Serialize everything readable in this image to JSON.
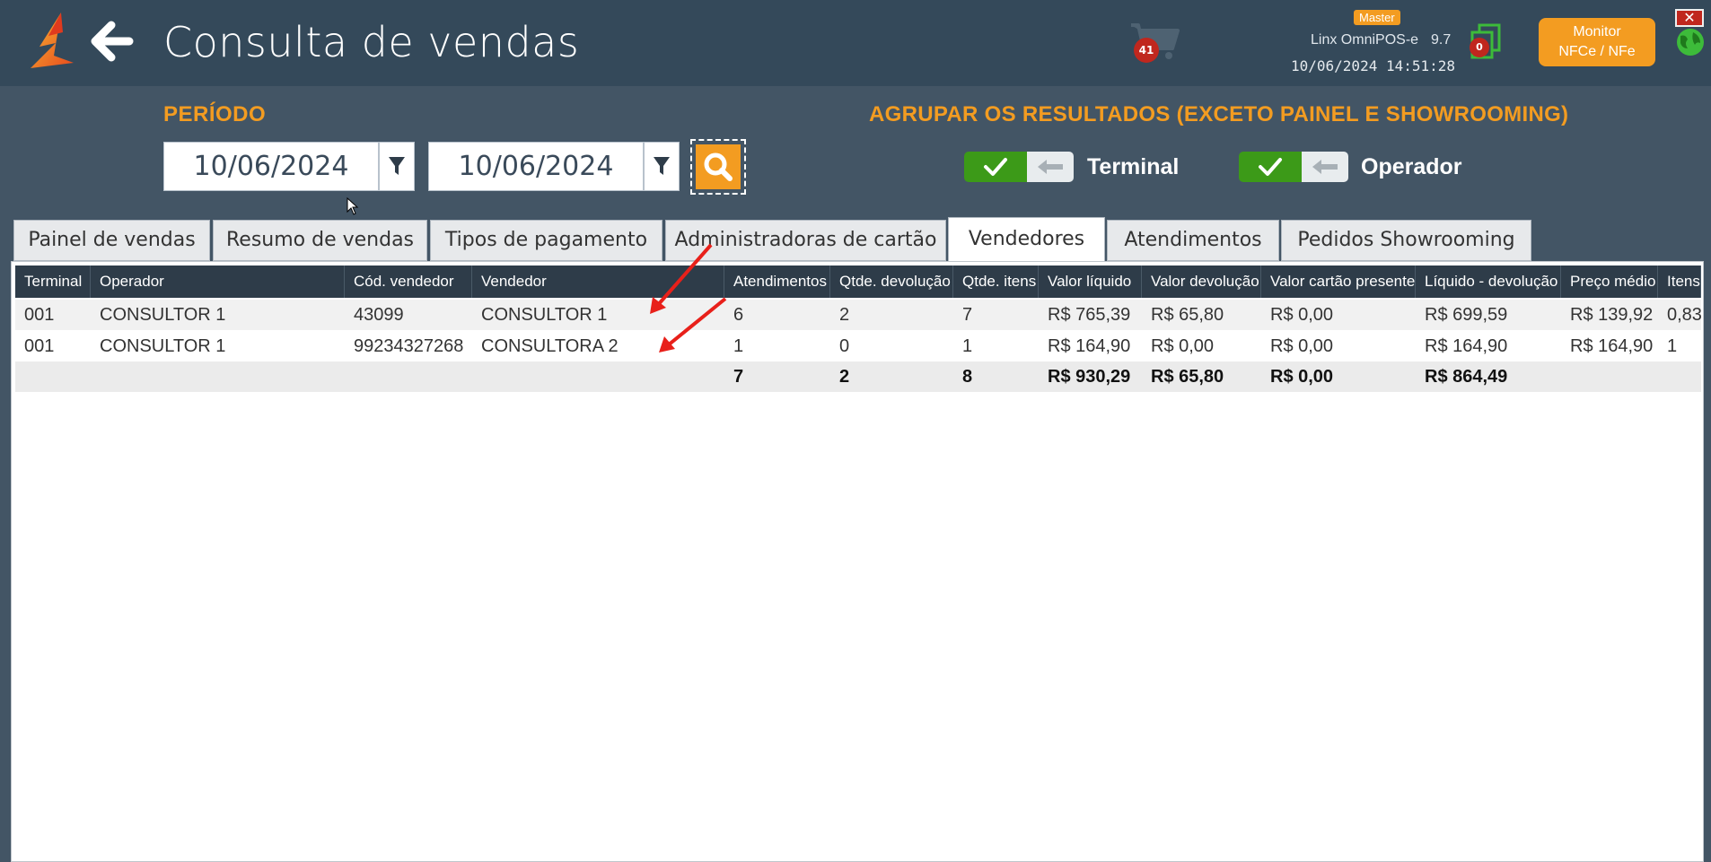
{
  "header": {
    "title": "Consulta de vendas",
    "cart_count": "41",
    "app_badge": "Master",
    "app_name": "Linx OmniPOS-e",
    "app_version": "9.7",
    "datetime": "10/06/2024 14:51:28",
    "docs_count": "0",
    "monitor_label_line1": "Monitor",
    "monitor_label_line2": "NFCe / NFe",
    "close_label": "✕"
  },
  "filters": {
    "periodo_label": "PERÍODO",
    "date_from": "10/06/2024",
    "date_to": "10/06/2024",
    "group_label": "AGRUPAR OS RESULTADOS (EXCETO PAINEL E SHOWROOMING)",
    "group_terminal": {
      "label": "Terminal",
      "checked": true
    },
    "group_operador": {
      "label": "Operador",
      "checked": true
    }
  },
  "tabs": [
    {
      "label": "Painel de vendas",
      "active": false
    },
    {
      "label": "Resumo de vendas",
      "active": false
    },
    {
      "label": "Tipos de pagamento",
      "active": false
    },
    {
      "label": "Administradoras de cartão",
      "active": false
    },
    {
      "label": "Vendedores",
      "active": true
    },
    {
      "label": "Atendimentos",
      "active": false
    },
    {
      "label": "Pedidos Showrooming",
      "active": false
    }
  ],
  "grid": {
    "columns": [
      "Terminal",
      "Operador",
      "Cód. vendedor",
      "Vendedor",
      "Atendimentos",
      "Qtde. devolução",
      "Qtde. itens",
      "Valor líquido",
      "Valor devolução",
      "Valor cartão presente",
      "Líquido - devolução",
      "Preço médio",
      "Itens p"
    ],
    "rows": [
      [
        "001",
        "CONSULTOR 1",
        "43099",
        "CONSULTOR 1",
        "6",
        "2",
        "7",
        "R$ 765,39",
        "R$ 65,80",
        "R$ 0,00",
        "R$ 699,59",
        "R$ 139,92",
        "0,83"
      ],
      [
        "001",
        "CONSULTOR 1",
        "99234327268",
        "CONSULTORA 2",
        "1",
        "0",
        "1",
        "R$ 164,90",
        "R$ 0,00",
        "R$ 0,00",
        "R$ 164,90",
        "R$ 164,90",
        "1"
      ]
    ],
    "totals": [
      "",
      "",
      "",
      "",
      "7",
      "2",
      "8",
      "R$ 930,29",
      "R$ 65,80",
      "R$ 0,00",
      "R$ 864,49",
      "",
      ""
    ]
  },
  "colors": {
    "topbar": "#34495a",
    "background": "#435565",
    "accent": "#f39c21",
    "toggle_on": "#3c9a18",
    "badge": "#c0271e",
    "grid_header": "#2e3c49",
    "annotation_arrow": "#e8201a"
  },
  "icons": {
    "logo": "linx-logo-icon",
    "back": "arrow-left-icon",
    "cart": "cart-icon",
    "docs": "documents-icon",
    "globe": "globe-icon",
    "filter": "funnel-icon",
    "search": "magnifier-icon",
    "check": "check-icon",
    "toggle_off": "arrow-left-icon"
  }
}
